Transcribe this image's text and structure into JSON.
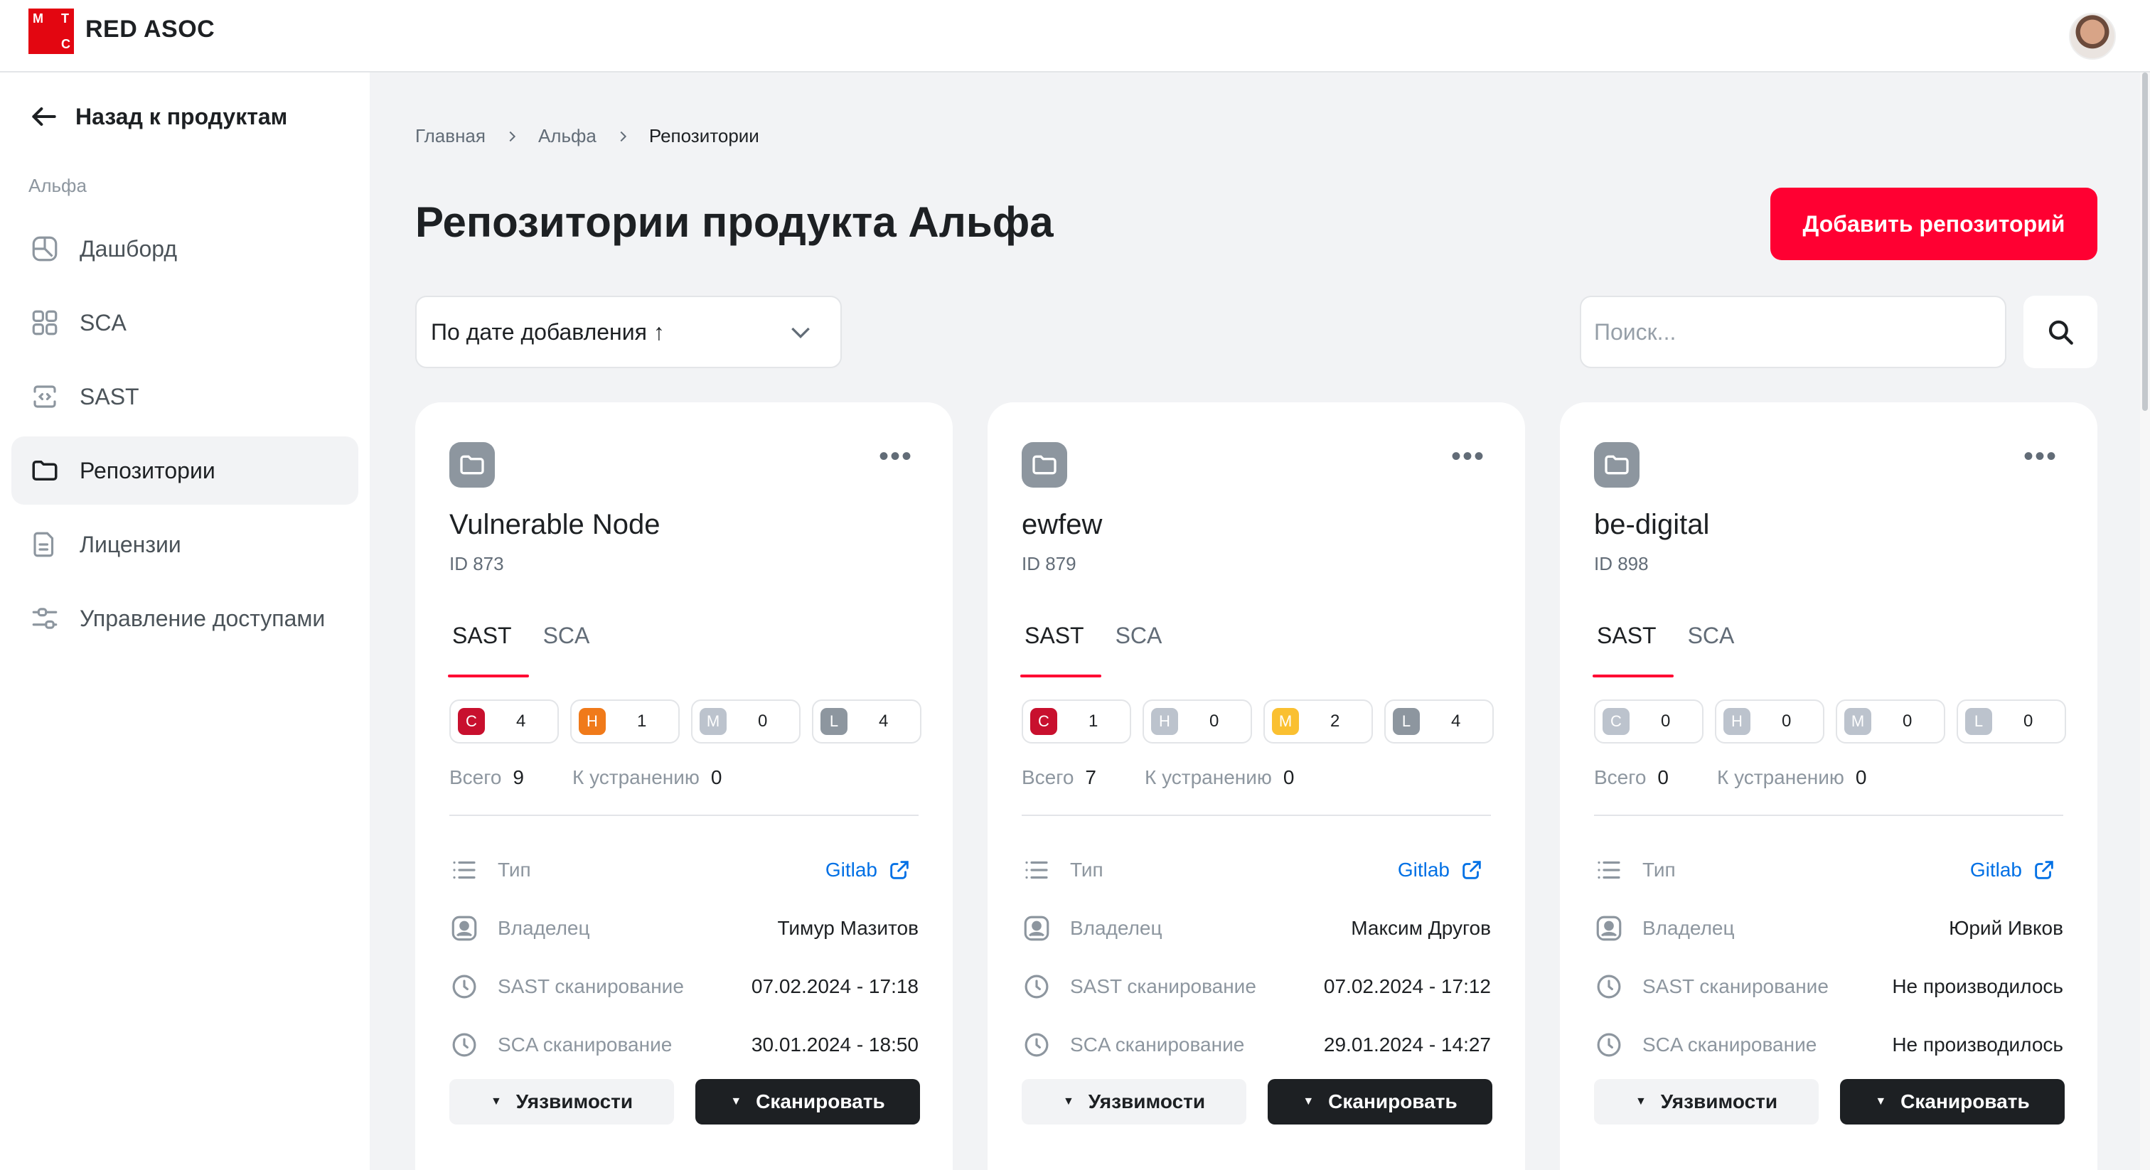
{
  "header": {
    "logo_letters": [
      "М",
      "Т",
      "С"
    ],
    "brand": "RED ASOC",
    "avatar_icon": "user-avatar"
  },
  "sidebar": {
    "back_label": "Назад к продуктам",
    "section_label": "Альфа",
    "items": [
      {
        "label": "Дашборд",
        "icon": "dashboard-icon",
        "active": false
      },
      {
        "label": "SCA",
        "icon": "grid-icon",
        "active": false
      },
      {
        "label": "SAST",
        "icon": "code-icon",
        "active": false
      },
      {
        "label": "Репозитории",
        "icon": "folder-icon",
        "active": true
      },
      {
        "label": "Лицензии",
        "icon": "document-icon",
        "active": false
      },
      {
        "label": "Управление доступами",
        "icon": "sliders-icon",
        "active": false
      }
    ]
  },
  "breadcrumb": [
    "Главная",
    "Альфа",
    "Репозитории"
  ],
  "page": {
    "title": "Репозитории продукта Альфа",
    "add_button": "Добавить репозиторий",
    "sort_value": "По дате добавления ↑",
    "search_placeholder": "Поиск..."
  },
  "colors": {
    "accent": "#ff0032",
    "critical": "#c8102e",
    "high": "#f07a1a",
    "medium": "#fac031",
    "low": "#8d969f",
    "inactive": "#bcc3cd",
    "link": "#0070e5"
  },
  "labels": {
    "tab_sast": "SAST",
    "tab_sca": "SCA",
    "total": "Всего",
    "to_fix": "К устранению",
    "type": "Тип",
    "owner": "Владелец",
    "sast_scan": "SAST сканирование",
    "sca_scan": "SCA сканирование",
    "vuln_button": "Уязвимости",
    "scan_button": "Сканировать"
  },
  "repos": [
    {
      "name": "Vulnerable Node",
      "id": "ID 873",
      "severities": [
        {
          "letter": "C",
          "count": "4",
          "active": true
        },
        {
          "letter": "H",
          "count": "1",
          "active": true
        },
        {
          "letter": "M",
          "count": "0",
          "active": false
        },
        {
          "letter": "L",
          "count": "4",
          "active": true
        }
      ],
      "total": "9",
      "to_fix": "0",
      "type": "Gitlab",
      "owner": "Тимур Мазитов",
      "sast_scan": "07.02.2024 - 17:18",
      "sca_scan": "30.01.2024 - 18:50"
    },
    {
      "name": "ewfew",
      "id": "ID 879",
      "severities": [
        {
          "letter": "C",
          "count": "1",
          "active": true
        },
        {
          "letter": "H",
          "count": "0",
          "active": false
        },
        {
          "letter": "M",
          "count": "2",
          "active": true
        },
        {
          "letter": "L",
          "count": "4",
          "active": true
        }
      ],
      "total": "7",
      "to_fix": "0",
      "type": "Gitlab",
      "owner": "Максим Другов",
      "sast_scan": "07.02.2024 - 17:12",
      "sca_scan": "29.01.2024 - 14:27"
    },
    {
      "name": "be-digital",
      "id": "ID 898",
      "severities": [
        {
          "letter": "C",
          "count": "0",
          "active": false
        },
        {
          "letter": "H",
          "count": "0",
          "active": false
        },
        {
          "letter": "M",
          "count": "0",
          "active": false
        },
        {
          "letter": "L",
          "count": "0",
          "active": false
        }
      ],
      "total": "0",
      "to_fix": "0",
      "type": "Gitlab",
      "owner": "Юрий Ивков",
      "sast_scan": "Не производилось",
      "sca_scan": "Не производилось"
    }
  ]
}
